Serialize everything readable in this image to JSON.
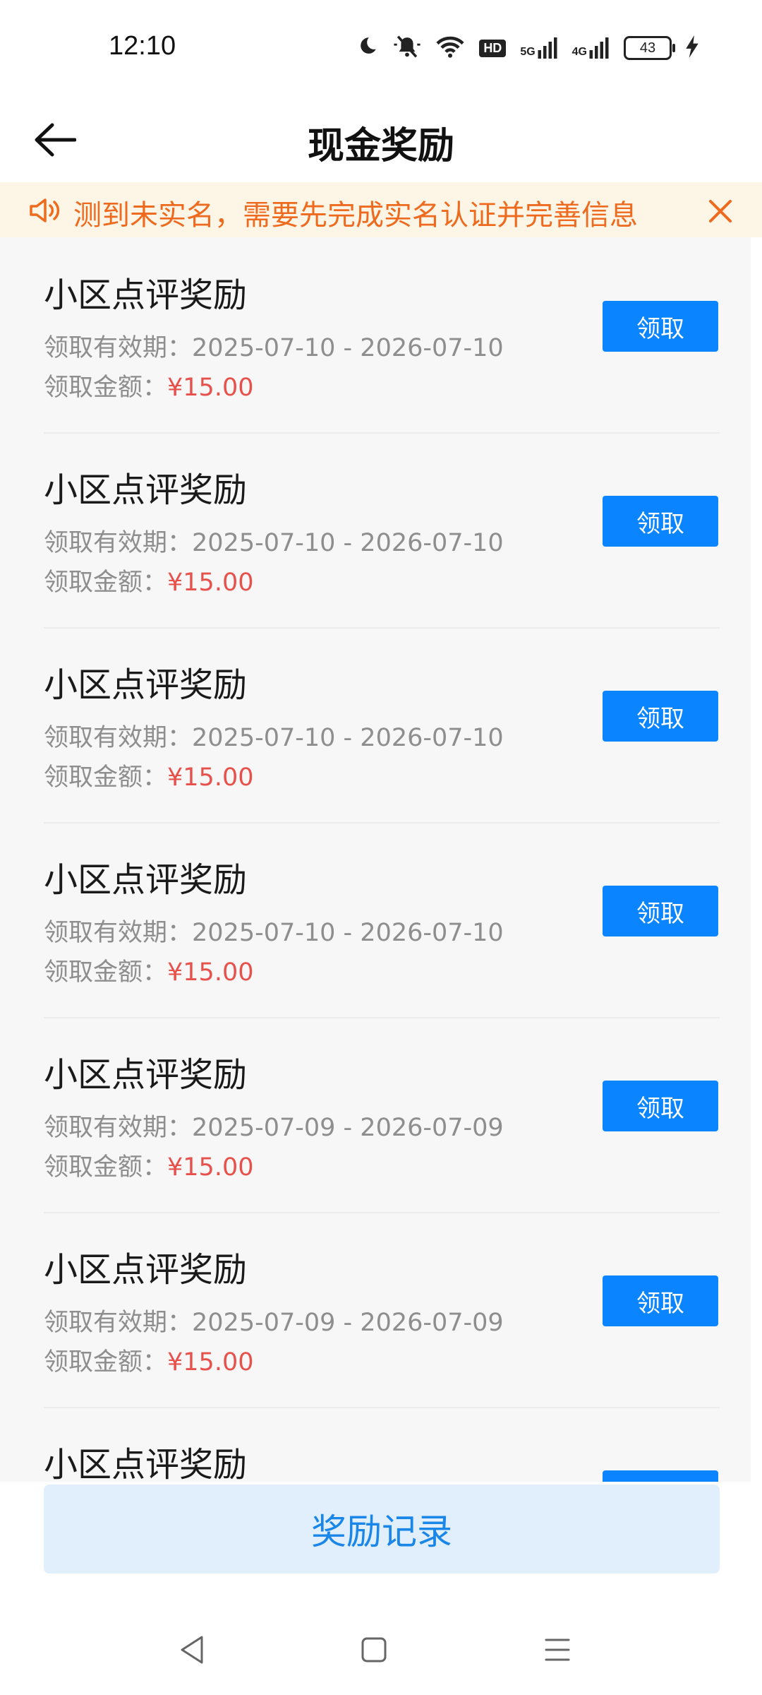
{
  "status_bar": {
    "time": "12:10",
    "battery": "43",
    "hd_label": "HD",
    "net_5g": "5G",
    "net_4g": "4G"
  },
  "header": {
    "title": "现金奖励",
    "back_icon": "arrow-left-icon"
  },
  "notice": {
    "text": "测到未实名，需要先完成实名认证并完善信息",
    "icon": "speaker-icon",
    "close_icon": "close-icon",
    "color": "#ee6a1e"
  },
  "rewards": [
    {
      "title": "小区点评奖励",
      "period_label": "领取有效期：",
      "period": "2025-07-10 - 2026-07-10",
      "amount_label": "领取金额：",
      "amount": "¥15.00",
      "button": "领取"
    },
    {
      "title": "小区点评奖励",
      "period_label": "领取有效期：",
      "period": "2025-07-10 - 2026-07-10",
      "amount_label": "领取金额：",
      "amount": "¥15.00",
      "button": "领取"
    },
    {
      "title": "小区点评奖励",
      "period_label": "领取有效期：",
      "period": "2025-07-10 - 2026-07-10",
      "amount_label": "领取金额：",
      "amount": "¥15.00",
      "button": "领取"
    },
    {
      "title": "小区点评奖励",
      "period_label": "领取有效期：",
      "period": "2025-07-10 - 2026-07-10",
      "amount_label": "领取金额：",
      "amount": "¥15.00",
      "button": "领取"
    },
    {
      "title": "小区点评奖励",
      "period_label": "领取有效期：",
      "period": "2025-07-09 - 2026-07-09",
      "amount_label": "领取金额：",
      "amount": "¥15.00",
      "button": "领取"
    },
    {
      "title": "小区点评奖励",
      "period_label": "领取有效期：",
      "period": "2025-07-09 - 2026-07-09",
      "amount_label": "领取金额：",
      "amount": "¥15.00",
      "button": "领取"
    },
    {
      "title": "小区点评奖励",
      "period_label": "",
      "period": "",
      "amount_label": "",
      "amount": "",
      "button": ""
    }
  ],
  "footer": {
    "record_button": "奖励记录"
  },
  "nav": {
    "back_icon": "nav-back-icon",
    "home_icon": "nav-home-icon",
    "menu_icon": "nav-menu-icon"
  },
  "colors": {
    "accent": "#0a84ff",
    "amount": "#e8514b",
    "notice_bg": "#fdf6e6"
  }
}
